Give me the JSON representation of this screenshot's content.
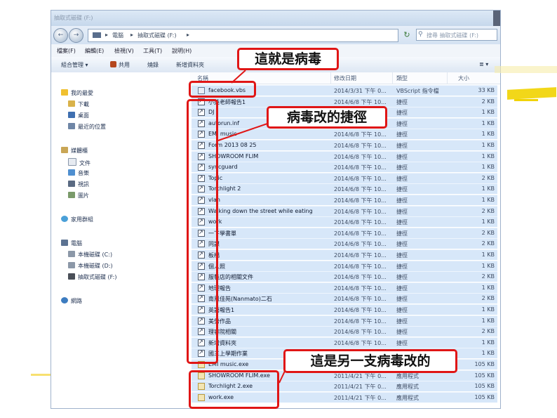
{
  "window": {
    "title": "抽取式磁碟 (F:)",
    "back_glyph": "←",
    "forward_glyph": "→",
    "breadcrumb": [
      "▸",
      "電腦",
      "▸",
      "抽取式磁碟 (F:)",
      "▸"
    ],
    "refresh_glyph": "↻",
    "search_placeholder": "搜尋 抽取式磁碟 (F:)"
  },
  "menu": [
    "檔案(F)",
    "編輯(E)",
    "檢視(V)",
    "工具(T)",
    "說明(H)"
  ],
  "toolbar": {
    "organize": "組合管理 ▾",
    "share": "共用",
    "burn": "燒錄",
    "new_folder": "新增資料夾",
    "view_label": "≣ ▾"
  },
  "sidebar": {
    "favorites": {
      "label": "我的最愛",
      "items": [
        "下載",
        "桌面",
        "最近的位置"
      ]
    },
    "libraries": {
      "label": "媒體櫃",
      "items": [
        "文件",
        "音樂",
        "視訊",
        "圖片"
      ]
    },
    "homegroup": {
      "label": "家用群組"
    },
    "computer": {
      "label": "電腦",
      "items": [
        "本機磁碟 (C:)",
        "本機磁碟 (D:)",
        "抽取式磁碟 (F:)"
      ]
    },
    "network": {
      "label": "網路"
    }
  },
  "columns": {
    "name": "名稱",
    "date": "修改日期",
    "type": "類型",
    "size": "大小"
  },
  "files": [
    {
      "name": "facebook.vbs",
      "date": "2014/3/31 下午 0...",
      "type": "VBScript 指令檔",
      "size": "33 KB",
      "icon": "vbs"
    },
    {
      "name": "小英老師報告1",
      "date": "2014/6/8 下午 10...",
      "type": "捷徑",
      "size": "2 KB",
      "icon": "shortcut"
    },
    {
      "name": "DJ",
      "date": "2014/6/8 下午 10...",
      "type": "捷徑",
      "size": "1 KB",
      "icon": "shortcut"
    },
    {
      "name": "autorun.inf",
      "date": "2014/6/8 下午 10...",
      "type": "捷徑",
      "size": "1 KB",
      "icon": "shortcut"
    },
    {
      "name": "EMI music",
      "date": "2014/6/8 下午 10...",
      "type": "捷徑",
      "size": "1 KB",
      "icon": "shortcut"
    },
    {
      "name": "Form 2013 08 25",
      "date": "2014/6/8 下午 10...",
      "type": "捷徑",
      "size": "1 KB",
      "icon": "shortcut"
    },
    {
      "name": "SHOWROOM FLIM",
      "date": "2014/6/8 下午 10...",
      "type": "捷徑",
      "size": "1 KB",
      "icon": "shortcut"
    },
    {
      "name": "syncguard",
      "date": "2014/6/8 下午 10...",
      "type": "捷徑",
      "size": "1 KB",
      "icon": "shortcut"
    },
    {
      "name": "Topic",
      "date": "2014/6/8 下午 10...",
      "type": "捷徑",
      "size": "2 KB",
      "icon": "shortcut"
    },
    {
      "name": "Torchlight 2",
      "date": "2014/6/8 下午 10...",
      "type": "捷徑",
      "size": "1 KB",
      "icon": "shortcut"
    },
    {
      "name": "vlan",
      "date": "2014/6/8 下午 10...",
      "type": "捷徑",
      "size": "1 KB",
      "icon": "shortcut"
    },
    {
      "name": "Walking down the street while eating",
      "date": "2014/6/8 下午 10...",
      "type": "捷徑",
      "size": "2 KB",
      "icon": "shortcut"
    },
    {
      "name": "work",
      "date": "2014/6/8 下午 10...",
      "type": "捷徑",
      "size": "1 KB",
      "icon": "shortcut"
    },
    {
      "name": "一下學書單",
      "date": "2014/6/8 下午 10...",
      "type": "捷徑",
      "size": "2 KB",
      "icon": "shortcut"
    },
    {
      "name": "同謀",
      "date": "2014/6/8 下午 10...",
      "type": "捷徑",
      "size": "2 KB",
      "icon": "shortcut"
    },
    {
      "name": "板橋",
      "date": "2014/6/8 下午 10...",
      "type": "捷徑",
      "size": "1 KB",
      "icon": "shortcut"
    },
    {
      "name": "個人照",
      "date": "2014/6/8 下午 10...",
      "type": "捷徑",
      "size": "1 KB",
      "icon": "shortcut"
    },
    {
      "name": "服裝店的相關文件",
      "date": "2014/6/8 下午 10...",
      "type": "捷徑",
      "size": "2 KB",
      "icon": "shortcut"
    },
    {
      "name": "地理報告",
      "date": "2014/6/8 下午 10...",
      "type": "捷徑",
      "size": "1 KB",
      "icon": "shortcut"
    },
    {
      "name": "南風佳苑(Nanmato)二石",
      "date": "2014/6/8 下午 10...",
      "type": "捷徑",
      "size": "2 KB",
      "icon": "shortcut"
    },
    {
      "name": "英語報告1",
      "date": "2014/6/8 下午 10...",
      "type": "捷徑",
      "size": "1 KB",
      "icon": "shortcut"
    },
    {
      "name": "美勞作品",
      "date": "2014/6/8 下午 10...",
      "type": "捷徑",
      "size": "1 KB",
      "icon": "shortcut"
    },
    {
      "name": "理容院相關",
      "date": "2014/6/8 下午 10...",
      "type": "捷徑",
      "size": "2 KB",
      "icon": "shortcut"
    },
    {
      "name": "新增資料夾",
      "date": "2014/6/8 下午 10...",
      "type": "捷徑",
      "size": "1 KB",
      "icon": "shortcut"
    },
    {
      "name": "國三上學期作業",
      "date": "2014/6/8 下午 10...",
      "type": "捷徑",
      "size": "1 KB",
      "icon": "shortcut"
    },
    {
      "name": "EMI music.exe",
      "date": "2011/4/21 下午 0...",
      "type": "應用程式",
      "size": "105 KB",
      "icon": "exe"
    },
    {
      "name": "SHOWROOM FLIM.exe",
      "date": "2011/4/21 下午 0...",
      "type": "應用程式",
      "size": "105 KB",
      "icon": "exe"
    },
    {
      "name": "Torchlight 2.exe",
      "date": "2011/4/21 下午 0...",
      "type": "應用程式",
      "size": "105 KB",
      "icon": "exe"
    },
    {
      "name": "work.exe",
      "date": "2011/4/21 下午 0...",
      "type": "應用程式",
      "size": "105 KB",
      "icon": "exe"
    }
  ],
  "annotations": {
    "virus": "這就是病毒",
    "virus_shortcuts": "病毒改的捷徑",
    "virus_exes": "這是另一支病毒改的"
  },
  "colors": {
    "highlight_red": "#e01616",
    "row_selected": "#d7e7f9",
    "window_chrome": "#c6d8ec"
  }
}
